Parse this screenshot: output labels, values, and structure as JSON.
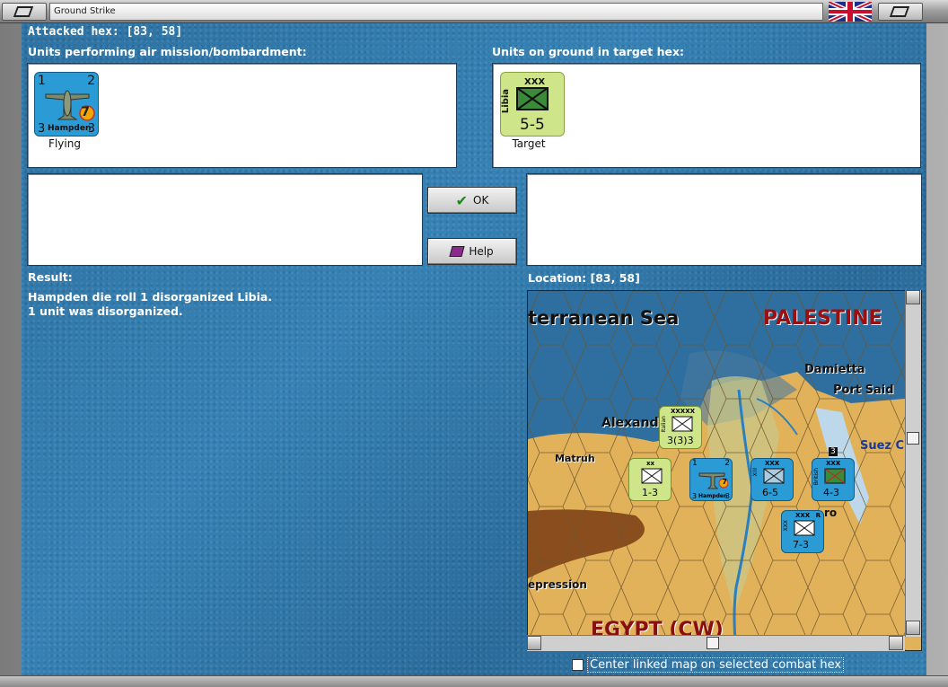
{
  "window": {
    "title": "Ground Strike"
  },
  "attacked_hex": "Attacked hex:  [83, 58]",
  "air_units_label": "Units performing air mission/bombardment:",
  "ground_units_label": "Units on ground in target hex:",
  "air_unit": {
    "name": "Hampden",
    "top_left": "1",
    "top_right": "2",
    "bottom_left": "3",
    "bottom_right": "3",
    "badge": "7",
    "caption": "Flying"
  },
  "ground_unit": {
    "name": "Libia",
    "size": "XXX",
    "strength": "5-5",
    "caption": "Target"
  },
  "buttons": {
    "ok": "OK",
    "help": "Help"
  },
  "result_label": "Result:",
  "result_lines": [
    "Hampden die roll 1 disorganized Libia.",
    "1 unit was disorganized."
  ],
  "location_label": "Location:  [83, 58]",
  "map": {
    "labels": {
      "sea": "terranean Sea",
      "palestine": "PALESTINE",
      "damietta": "Damietta",
      "port_said": "Port Said",
      "alexand": "Alexand",
      "suez": "Suez C",
      "matruh": "Matruh",
      "epression": "epression",
      "egypt": "EGYPT (CW)",
      "ro": "ro"
    },
    "counters": {
      "a": {
        "size": "XXXXX",
        "strength": "3(3)3",
        "side": "Italian"
      },
      "b": {
        "size": "xx",
        "strength": "1-3"
      },
      "c": {
        "name": "Hampden",
        "tl": "1",
        "tr": "2",
        "bl": "3",
        "br": "3",
        "badge": "7"
      },
      "d": {
        "size": "XXX",
        "strength": "6-5",
        "side": "XIII"
      },
      "e": {
        "size": "XXX",
        "strength": "4-3",
        "stack": "3",
        "side": "British"
      },
      "f": {
        "size": "XXX",
        "strength": "7-3",
        "side": "XXX",
        "r": "R"
      }
    }
  },
  "checkbox_label": "Center linked map on selected combat hex",
  "colors": {
    "water": "#2f75a6",
    "ground_counter": "#cfe58a",
    "air_counter": "#2a9bd4",
    "desert": "#e4b35a"
  }
}
